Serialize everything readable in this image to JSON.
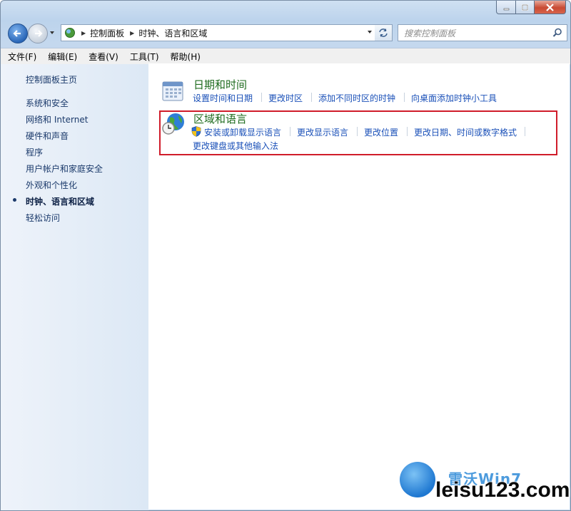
{
  "window": {
    "caption_buttons": [
      "minimize-icon",
      "maximize-icon",
      "close-icon"
    ]
  },
  "address_bar": {
    "breadcrumbs": [
      "控制面板",
      "时钟、语言和区域"
    ],
    "search_placeholder": "搜索控制面板"
  },
  "menu": {
    "items": [
      "文件(F)",
      "编辑(E)",
      "查看(V)",
      "工具(T)",
      "帮助(H)"
    ]
  },
  "sidebar": {
    "home": "控制面板主页",
    "items": [
      {
        "label": "系统和安全"
      },
      {
        "label": "网络和 Internet"
      },
      {
        "label": "硬件和声音"
      },
      {
        "label": "程序"
      },
      {
        "label": "用户帐户和家庭安全"
      },
      {
        "label": "外观和个性化"
      },
      {
        "label": "时钟、语言和区域",
        "current": true
      },
      {
        "label": "轻松访问"
      }
    ]
  },
  "categories": [
    {
      "title": "日期和时间",
      "icon": "calendar-clock-icon",
      "links": [
        "设置时间和日期",
        "更改时区",
        "添加不同时区的时钟",
        "向桌面添加时钟小工具"
      ]
    },
    {
      "title": "区域和语言",
      "icon": "globe-clock-icon",
      "links": [
        "安装或卸载显示语言",
        "更改显示语言",
        "更改位置",
        "更改日期、时间或数字格式",
        "更改键盘或其他输入法"
      ]
    }
  ],
  "watermark": {
    "logo_text": "雷沃Win7",
    "url": "leisu123.com"
  },
  "colors": {
    "highlight_border": "#d01c2a",
    "category_title": "#1e6b1e",
    "task_link": "#1a50b8"
  }
}
